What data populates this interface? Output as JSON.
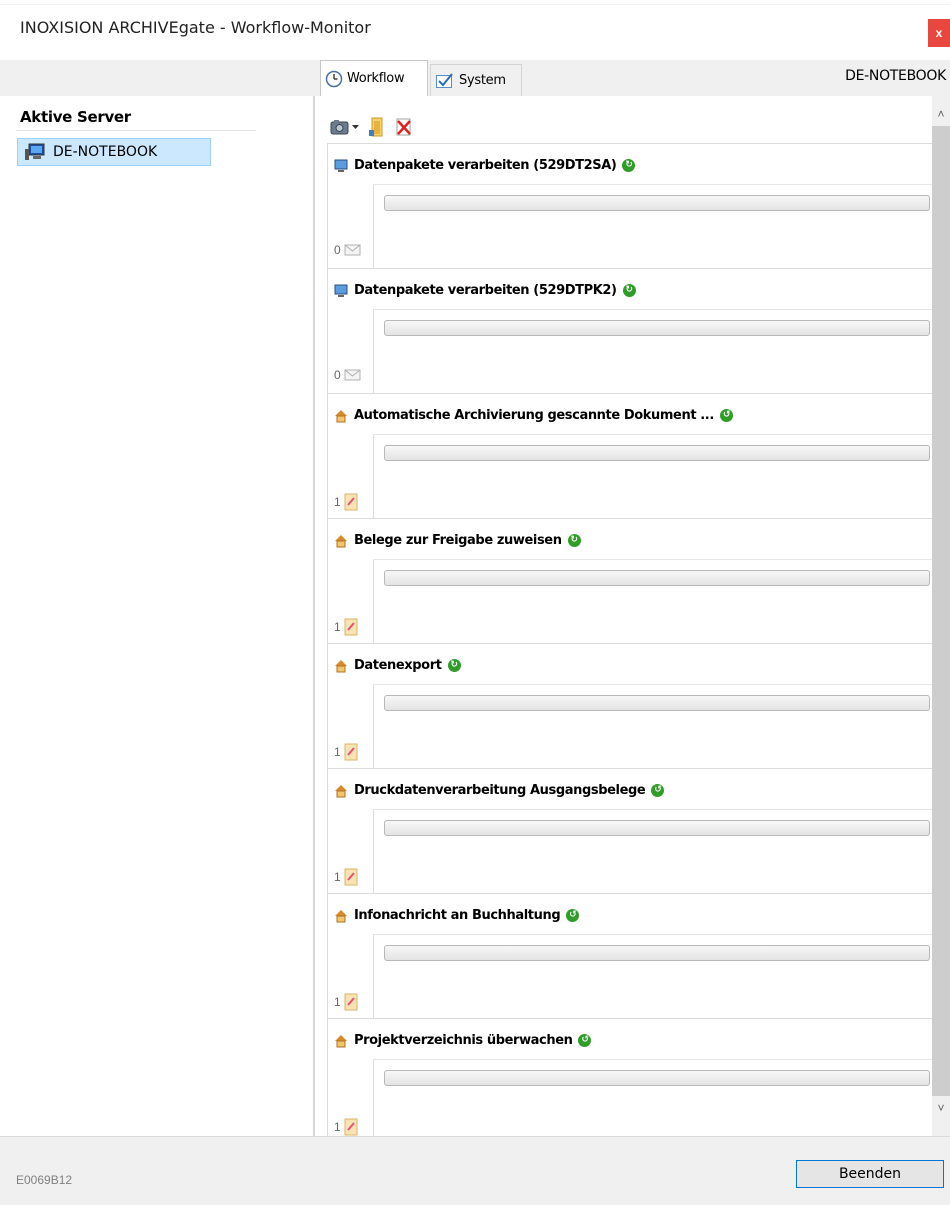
{
  "window": {
    "title": "INOXISION ARCHIVEgate  -  Workflow-Monitor",
    "close_label": "x"
  },
  "tabs": [
    {
      "label": "Workflow",
      "icon": "clock-icon",
      "active": true
    },
    {
      "label": "System",
      "icon": "checkbox-icon",
      "active": false
    }
  ],
  "current_server": "DE-NOTEBOOK",
  "sidebar": {
    "heading": "Aktive Server",
    "items": [
      {
        "label": "DE-NOTEBOOK",
        "icon": "computer-icon",
        "selected": true
      }
    ]
  },
  "toolbar": {
    "items": [
      "camera-dropdown-icon",
      "folder-icon",
      "delete-icon"
    ]
  },
  "workflows": [
    {
      "title": "Datenpakete verarbeiten (529DT2SA)",
      "icon": "monitor-icon",
      "status_icon": "refresh-icon",
      "count": "0",
      "count_icon": "envelope-icon",
      "progress": 0
    },
    {
      "title": "Datenpakete verarbeiten (529DTPK2)",
      "icon": "monitor-icon",
      "status_icon": "refresh-icon",
      "count": "0",
      "count_icon": "envelope-icon",
      "progress": 0
    },
    {
      "title": "Automatische Archivierung gescannte Dokument ...",
      "icon": "house-icon",
      "status_icon": "cycle-icon",
      "count": "1",
      "count_icon": "document-icon",
      "progress": 0
    },
    {
      "title": "Belege zur Freigabe zuweisen",
      "icon": "house-icon",
      "status_icon": "refresh-icon",
      "count": "1",
      "count_icon": "document-icon",
      "progress": 0
    },
    {
      "title": "Datenexport",
      "icon": "house-icon",
      "status_icon": "refresh-icon",
      "count": "1",
      "count_icon": "document-icon",
      "progress": 0
    },
    {
      "title": "Druckdatenverarbeitung Ausgangsbelege",
      "icon": "house-icon",
      "status_icon": "cycle-icon",
      "count": "1",
      "count_icon": "document-icon",
      "progress": 0
    },
    {
      "title": "Infonachricht an Buchhaltung",
      "icon": "house-icon",
      "status_icon": "cycle-icon",
      "count": "1",
      "count_icon": "document-icon",
      "progress": 0
    },
    {
      "title": "Projektverzeichnis überwachen",
      "icon": "house-icon",
      "status_icon": "cycle-icon",
      "count": "1",
      "count_icon": "document-icon",
      "progress": 0
    }
  ],
  "footer": {
    "code": "E0069B12",
    "exit_label": "Beenden"
  },
  "colors": {
    "accent": "#0078d7",
    "selection": "#cce8ff",
    "close": "#e8473f",
    "status_green": "#2f9d27"
  }
}
